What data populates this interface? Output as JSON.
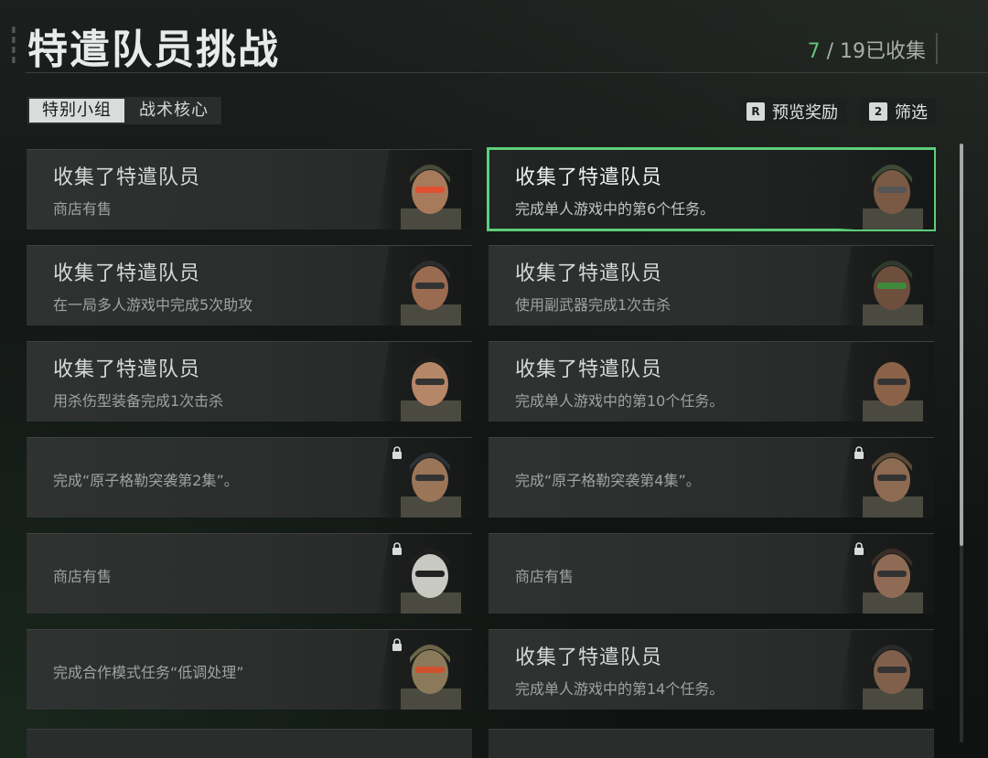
{
  "header": {
    "title": "特遣队员挑战",
    "collected": "7",
    "total": " / 19已收集"
  },
  "tabs": [
    {
      "label": "特别小组",
      "active": true
    },
    {
      "label": "战术核心",
      "active": false
    }
  ],
  "actions": [
    {
      "key": "R",
      "label": "预览奖励"
    },
    {
      "key": "2",
      "label": "筛选"
    }
  ],
  "cards": [
    {
      "heading": "收集了特遣队员",
      "desc": "商店有售",
      "locked": false,
      "selected": false,
      "icon": "operator-portrait-helmet-goggles"
    },
    {
      "heading": "收集了特遣队员",
      "desc": "完成单人游戏中的第6个任务。",
      "locked": false,
      "selected": true,
      "icon": "operator-portrait-camo-helmet"
    },
    {
      "heading": "收集了特遣队员",
      "desc": "在一局多人游戏中完成5次助攻",
      "locked": false,
      "selected": false,
      "icon": "operator-portrait-beanie"
    },
    {
      "heading": "收集了特遣队员",
      "desc": "使用副武器完成1次击杀",
      "locked": false,
      "selected": false,
      "icon": "operator-portrait-green-goggles"
    },
    {
      "heading": "收集了特遣队员",
      "desc": "用杀伤型装备完成1次击杀",
      "locked": false,
      "selected": false,
      "icon": "operator-portrait-beret"
    },
    {
      "heading": "收集了特遣队员",
      "desc": "完成单人游戏中的第10个任务。",
      "locked": false,
      "selected": false,
      "icon": "operator-portrait-female"
    },
    {
      "heading": "",
      "desc": "完成“原子格勒突袭第2集”。",
      "locked": true,
      "selected": false,
      "icon": "operator-portrait-boonie-hat"
    },
    {
      "heading": "",
      "desc": "完成“原子格勒突袭第4集”。",
      "locked": true,
      "selected": false,
      "icon": "operator-portrait-hood"
    },
    {
      "heading": "",
      "desc": "商店有售",
      "locked": true,
      "selected": false,
      "icon": "operator-portrait-skull-mask"
    },
    {
      "heading": "",
      "desc": "商店有售",
      "locked": true,
      "selected": false,
      "icon": "operator-portrait-scarred"
    },
    {
      "heading": "",
      "desc": "完成合作模式任务“低调处理”",
      "locked": true,
      "selected": false,
      "icon": "operator-portrait-ghillie"
    },
    {
      "heading": "收集了特遣队员",
      "desc": "完成单人游戏中的第14个任务。",
      "locked": false,
      "selected": false,
      "icon": "operator-portrait-headset"
    }
  ],
  "colors": {
    "accent_green": "#5ccf7a",
    "counter_green": "#67c27a"
  },
  "scroll": {
    "position_fraction": 0.0,
    "visible_fraction": 0.67
  }
}
